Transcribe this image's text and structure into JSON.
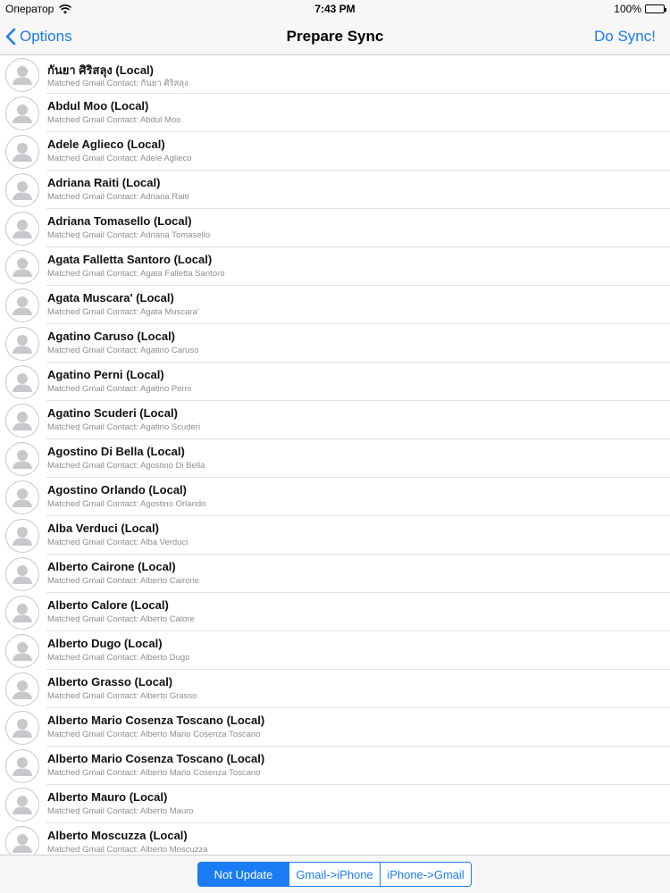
{
  "status_bar": {
    "carrier": "Оператор",
    "time": "7:43 PM",
    "battery": "100%"
  },
  "nav": {
    "back_label": "Options",
    "title": "Prepare Sync",
    "action_label": "Do Sync!"
  },
  "contacts": [
    {
      "name": "กันยา ศิริสลุง (Local)",
      "match": "Matched Gmail Contact: กันยา ศิริสลุง"
    },
    {
      "name": "Abdul Moo (Local)",
      "match": "Matched Gmail Contact: Abdul Moo"
    },
    {
      "name": "Adele Aglieco (Local)",
      "match": "Matched Gmail Contact: Adele Aglieco"
    },
    {
      "name": "Adriana Raiti (Local)",
      "match": "Matched Gmail Contact: Adriana Raiti"
    },
    {
      "name": "Adriana Tomasello (Local)",
      "match": "Matched Gmail Contact: Adriana Tomasello"
    },
    {
      "name": "Agata Falletta Santoro (Local)",
      "match": "Matched Gmail Contact: Agata Falletta Santoro"
    },
    {
      "name": "Agata Muscara' (Local)",
      "match": "Matched Gmail Contact: Agata Muscara'"
    },
    {
      "name": "Agatino Caruso (Local)",
      "match": "Matched Gmail Contact: Agatino Caruso"
    },
    {
      "name": "Agatino Perni (Local)",
      "match": "Matched Gmail Contact: Agatino Perni"
    },
    {
      "name": "Agatino Scuderi (Local)",
      "match": "Matched Gmail Contact: Agatino Scuderi"
    },
    {
      "name": "Agostino Di Bella (Local)",
      "match": "Matched Gmail Contact: Agostino Di Bella"
    },
    {
      "name": "Agostino Orlando (Local)",
      "match": "Matched Gmail Contact: Agostino Orlando"
    },
    {
      "name": "Alba Verduci (Local)",
      "match": "Matched Gmail Contact: Alba Verduci"
    },
    {
      "name": "Alberto Cairone (Local)",
      "match": "Matched Gmail Contact: Alberto Cairone"
    },
    {
      "name": "Alberto Calore (Local)",
      "match": "Matched Gmail Contact: Alberto Calore"
    },
    {
      "name": "Alberto Dugo (Local)",
      "match": "Matched Gmail Contact: Alberto Dugo"
    },
    {
      "name": "Alberto Grasso (Local)",
      "match": "Matched Gmail Contact: Alberto Grasso"
    },
    {
      "name": "Alberto Mario Cosenza Toscano (Local)",
      "match": "Matched Gmail Contact: Alberto Mario Cosenza Toscano"
    },
    {
      "name": "Alberto Mario Cosenza Toscano (Local)",
      "match": "Matched Gmail Contact: Alberto Mario Cosenza Toscano"
    },
    {
      "name": "Alberto Mauro (Local)",
      "match": "Matched Gmail Contact: Alberto Mauro"
    },
    {
      "name": "Alberto Moscuzza (Local)",
      "match": "Matched Gmail Contact: Alberto Moscuzza"
    }
  ],
  "sync_modes": {
    "options": [
      "Not Update",
      "Gmail->iPhone",
      "iPhone->Gmail"
    ],
    "selected": "Not Update"
  },
  "colors": {
    "accent": "#1a7cf4",
    "bar_background": "#f7f7f7",
    "subtitle": "#8e8e93"
  }
}
